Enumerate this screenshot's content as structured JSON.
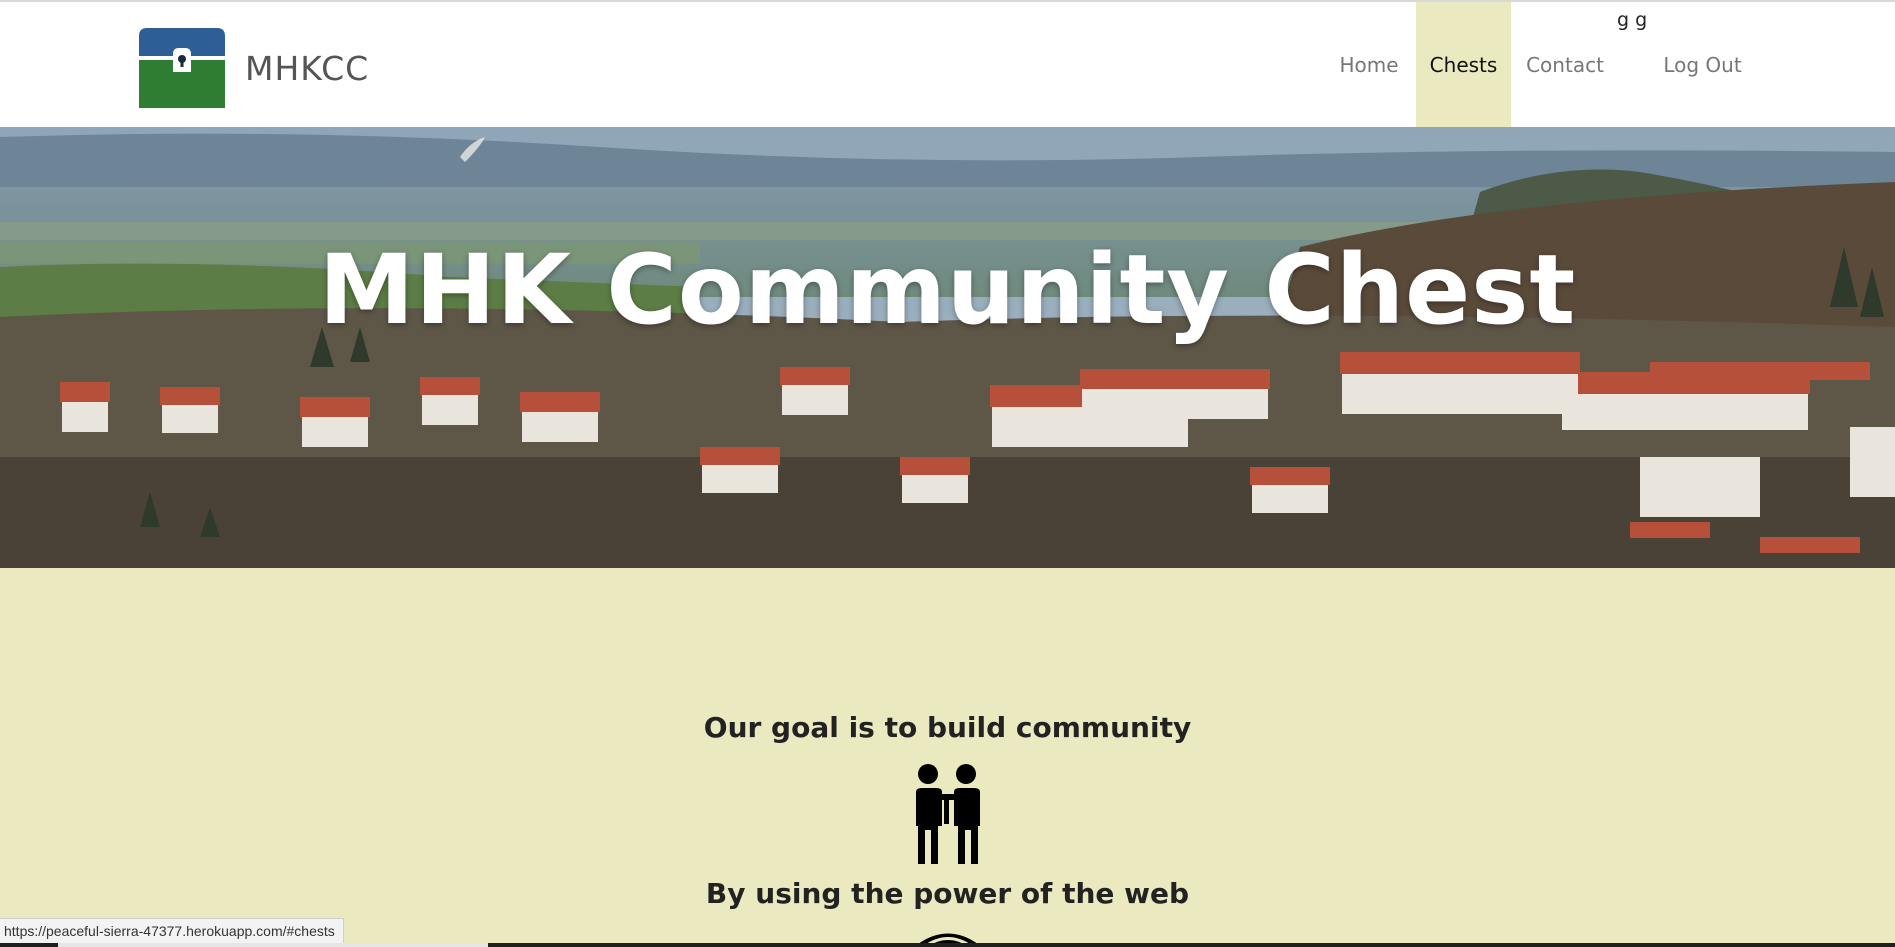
{
  "brand": {
    "name": "MHKCC",
    "logo_icon": "treasure-chest-icon",
    "logo_colors": {
      "top": "#2d5f96",
      "bottom": "#2e7d32"
    }
  },
  "user": {
    "name": "g g"
  },
  "nav": {
    "items": [
      {
        "label": "Home",
        "active": false
      },
      {
        "label": "Chests",
        "active": true
      },
      {
        "label": "Contact",
        "active": false
      },
      {
        "label": "Log Out",
        "active": false
      }
    ],
    "active_color": "#ebe9bf"
  },
  "hero": {
    "title": "MHK Community Chest",
    "image": "town-landscape-photo"
  },
  "content": {
    "goal": "Our goal is to build community",
    "goal_icon": "people-icon",
    "power": "By using the power of the web"
  },
  "status_bar": {
    "url": "https://peaceful-sierra-47377.herokuapp.com/#chests"
  },
  "colors": {
    "page_background": "#ebe9bf",
    "navbar": "#ffffff"
  }
}
